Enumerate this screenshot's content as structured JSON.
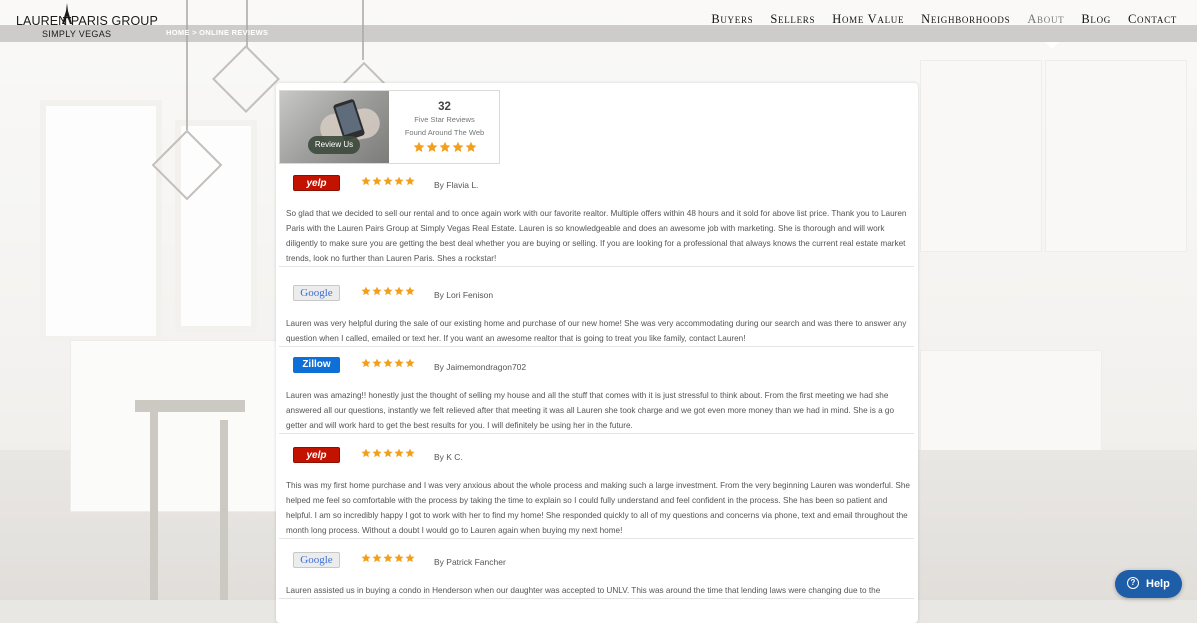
{
  "header": {
    "logo_name": "LAUREN PARIS GROUP",
    "logo_sub": "SIMPLY VEGAS",
    "nav": [
      "Buyers",
      "Sellers",
      "Home Value",
      "Neighborhoods",
      "About",
      "Blog",
      "Contact"
    ],
    "active_nav": "About",
    "breadcrumb": "HOME  >  ONLINE REVIEWS"
  },
  "summary": {
    "button": "Review Us",
    "count": "32",
    "line1": "Five Star Reviews",
    "line2": "Found Around The Web",
    "rating": 5
  },
  "reviews": [
    {
      "source": "yelp",
      "source_label": "yelp",
      "rating": 5,
      "author": "By Flavia L.",
      "text": "So glad that we decided to sell our rental and to once again work with our favorite realtor. Multiple offers within 48 hours and it sold for above list price. Thank you to Lauren Paris with the Lauren Pairs Group at Simply Vegas Real Estate. Lauren is so knowledgeable and does an awesome job with marketing. She is thorough and will work diligently to make sure you are getting the best deal whether you are buying or selling. If you are looking for a professional that always knows the current real estate market trends, look no further than Lauren Paris. Shes a rockstar!"
    },
    {
      "source": "google",
      "source_label": "Google",
      "rating": 5,
      "author": "By Lori Fenison",
      "text": "Lauren was very helpful during the sale of our existing home and purchase of our new home! She was very accommodating during our search and was there to answer any question when I called, emailed or text her. If you want an awesome realtor that is going to treat you like family, contact Lauren!"
    },
    {
      "source": "zillow",
      "source_label": "Zillow",
      "rating": 5,
      "author": "By Jaimemondragon702",
      "text": "Lauren was amazing!! honestly just the thought of selling my house and all the stuff that comes with it is just stressful to think about. From the first meeting we had she answered all our questions, instantly we felt relieved after that meeting it was all Lauren she took charge and we got even more money than we had in mind. She is a go getter and will work hard to get the best results for you. I will definitely be using her in the future."
    },
    {
      "source": "yelp",
      "source_label": "yelp",
      "rating": 5,
      "author": "By K C.",
      "text": "This was my first home purchase and I was very anxious about the whole process and making such a large investment. From the very beginning Lauren was wonderful. She helped me feel so comfortable with the process by taking the time to explain so I could fully understand and feel confident in the process. She has been so patient and helpful. I am so incredibly happy I got to work with her to find my home! She responded quickly to all of my questions and concerns via phone, text and email throughout the month long process. Without a doubt I would go to Lauren again when buying my next home!"
    },
    {
      "source": "google",
      "source_label": "Google",
      "rating": 5,
      "author": "By Patrick Fancher",
      "text": "Lauren assisted us in buying a condo in Henderson when our daughter was accepted to UNLV. This was around the time that lending laws were changing due to the"
    }
  ],
  "help": {
    "label": "Help"
  },
  "colors": {
    "star": "#f2a01c",
    "yelp": "#c41200",
    "zillow": "#0e6fd6",
    "help": "#1e5ea8"
  }
}
